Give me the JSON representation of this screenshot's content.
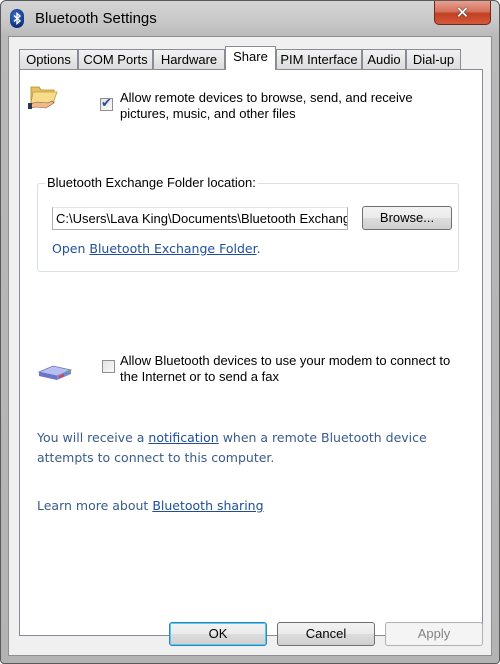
{
  "window": {
    "title": "Bluetooth Settings",
    "close_label": "✕"
  },
  "tabs": [
    {
      "label": "Options",
      "active": false
    },
    {
      "label": "COM Ports",
      "active": false
    },
    {
      "label": "Hardware",
      "active": false
    },
    {
      "label": "Share",
      "active": true
    },
    {
      "label": "PIM Interface",
      "active": false
    },
    {
      "label": "Audio",
      "active": false
    },
    {
      "label": "Dial-up",
      "active": false
    }
  ],
  "share": {
    "allow_files": {
      "label_line1": "Allow remote devices to browse, send, and receive",
      "label_line2": "pictures, music, and other files",
      "checked": true
    },
    "exchange_group": {
      "legend": "Bluetooth Exchange Folder location:",
      "path_value": "C:\\Users\\Lava King\\Documents\\Bluetooth Exchange Folder",
      "browse_label": "Browse...",
      "open_prefix": "Open ",
      "open_link": "Bluetooth Exchange Folder",
      "open_suffix": "."
    },
    "allow_modem": {
      "label_line1": "Allow Bluetooth devices to use your modem to connect to",
      "label_line2": "the Internet or to send a fax",
      "checked": false
    },
    "notification": {
      "prefix": "You will receive a ",
      "link": "notification",
      "suffix_line1": " when a remote Bluetooth device",
      "line2": "attempts to connect to this computer."
    },
    "learn_more": {
      "prefix": "Learn more about ",
      "link": "Bluetooth sharing"
    }
  },
  "footer": {
    "ok_label": "OK",
    "cancel_label": "Cancel",
    "apply_label": "Apply",
    "apply_enabled": false
  }
}
